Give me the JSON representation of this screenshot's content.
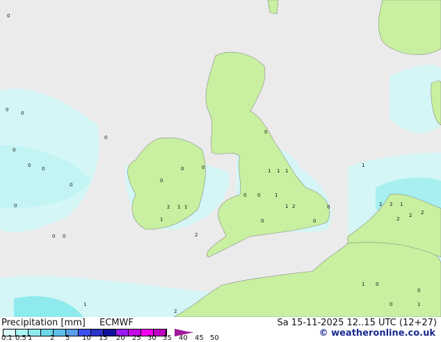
{
  "title": "Precipitation [mm]",
  "model": "ECMWF",
  "datetime": "Sa 15-11-2025 12..15 UTC (12+27)",
  "credit": "© weatheronline.co.uk",
  "legend": {
    "ticks": [
      "0.1",
      "0.5",
      "1",
      "2",
      "5",
      "10",
      "15",
      "20",
      "25",
      "30",
      "35",
      "40",
      "45",
      "50"
    ],
    "colors": [
      "#dcfafa",
      "#aaf5f5",
      "#8eeaec",
      "#6ed8e8",
      "#5ec0ea",
      "#5a9ee8",
      "#3c50f0",
      "#2a34c8",
      "#10109e",
      "#9a1af0",
      "#c80ae8",
      "#f000f0",
      "#c000c0"
    ],
    "arrow_color": "#a0189c"
  },
  "colors": {
    "sea": "#ebebeb",
    "land": "#c8f0a0",
    "precip_light": "#d4f6f6",
    "precip_mid": "#a8f0f0",
    "precip_heavy": "#7ad8ea",
    "coast": "#888888"
  },
  "map_values": [
    "0",
    "0",
    "0",
    "0",
    "0",
    "0",
    "0",
    "0",
    "0",
    "0",
    "0",
    "0",
    "0",
    "1",
    "1",
    "1",
    "1",
    "2",
    "2",
    "2",
    "0",
    "0",
    "1",
    "1",
    "2",
    "2",
    "2",
    "1",
    "1",
    "1",
    "0",
    "0",
    "0",
    "1",
    "2",
    "2",
    "1",
    "0",
    "0",
    "0",
    "1",
    "2",
    "1",
    "0",
    "0"
  ]
}
